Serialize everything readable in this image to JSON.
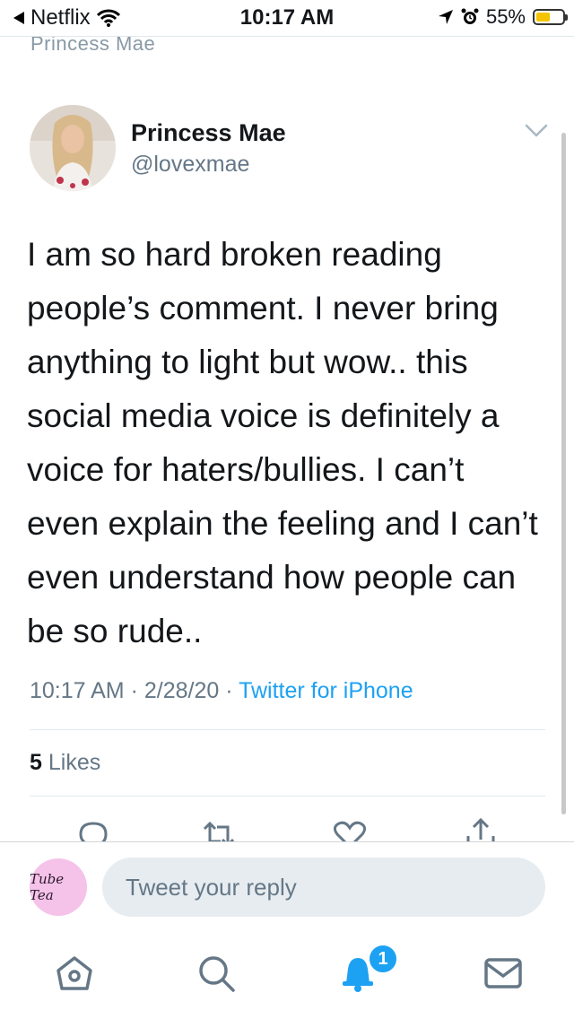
{
  "status_bar": {
    "back_app": "Netflix",
    "time": "10:17 AM",
    "battery_percent": "55%",
    "battery_level": 0.55
  },
  "nav": {
    "title": "Princess Mae"
  },
  "tweet": {
    "author_name": "Princess Mae",
    "author_handle": "@lovexmae",
    "text": "I am so hard broken reading people’s comment. I never bring anything to light but wow.. this social media voice is definitely a voice for haters/bullies. I can’t even explain the feeling and I can’t even understand how people can be so rude..",
    "time": "10:17 AM",
    "date": "2/28/20",
    "source": "Twitter for iPhone",
    "likes_count": "5",
    "likes_label": "Likes"
  },
  "reply": {
    "avatar_text": "Tube Tea",
    "placeholder": "Tweet your reply"
  },
  "tab_bar": {
    "notifications_badge": "1",
    "items": [
      "home-icon",
      "search-icon",
      "notifications-icon",
      "messages-icon"
    ]
  },
  "colors": {
    "accent": "#1da1f2",
    "secondary_text": "#657786",
    "reply_field_bg": "#e6ecf0",
    "battery_fill": "#f5c400"
  }
}
